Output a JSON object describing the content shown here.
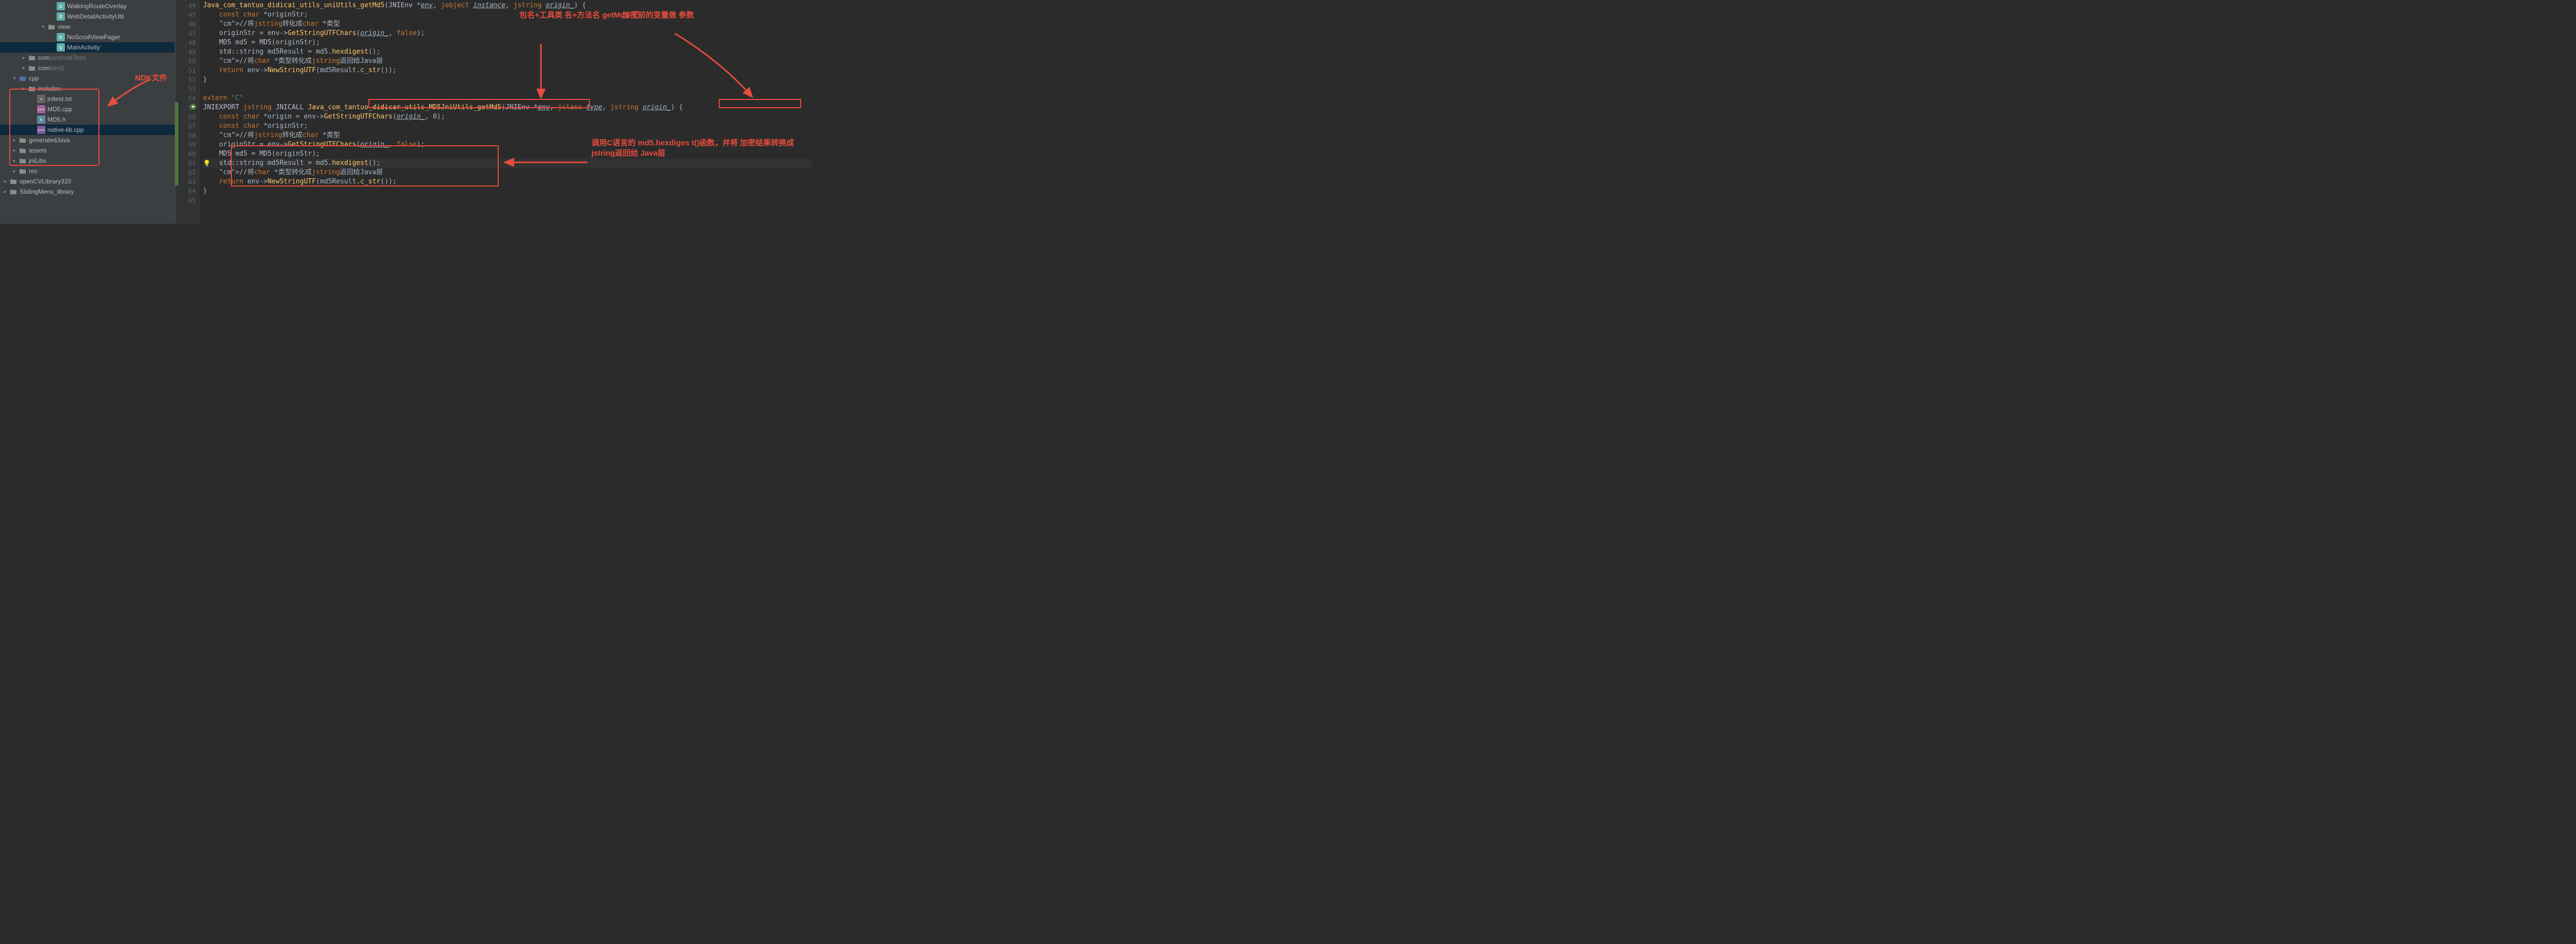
{
  "sidebar": {
    "items": [
      {
        "indent": 96,
        "arrow": "",
        "icon": "c",
        "label": "WalkingRouteOverlay"
      },
      {
        "indent": 96,
        "arrow": "",
        "icon": "c",
        "label": "WebDetailActivityUtil"
      },
      {
        "indent": 78,
        "arrow": "▾",
        "icon": "fo",
        "label": "view"
      },
      {
        "indent": 96,
        "arrow": "",
        "icon": "c",
        "label": "NoScrollViewPager"
      },
      {
        "indent": 96,
        "arrow": "",
        "icon": "c",
        "label": "MainActivity",
        "sel": true
      },
      {
        "indent": 40,
        "arrow": "▸",
        "icon": "fo",
        "label": "com",
        "suffix": " (androidTest)"
      },
      {
        "indent": 40,
        "arrow": "▸",
        "icon": "fo",
        "label": "com",
        "suffix": " (test)"
      },
      {
        "indent": 22,
        "arrow": "▾",
        "icon": "fob",
        "label": "cpp"
      },
      {
        "indent": 40,
        "arrow": "▸",
        "icon": "fo",
        "label": "includes"
      },
      {
        "indent": 58,
        "arrow": "",
        "icon": "txt",
        "label": "jnitest.txt"
      },
      {
        "indent": 58,
        "arrow": "",
        "icon": "cpp",
        "label": "MD5.cpp"
      },
      {
        "indent": 58,
        "arrow": "",
        "icon": "h",
        "label": "MD5.h"
      },
      {
        "indent": 58,
        "arrow": "",
        "icon": "cpp2",
        "label": "native-lib.cpp",
        "sel": true
      },
      {
        "indent": 22,
        "arrow": "▸",
        "icon": "fo",
        "label": "generatedJava"
      },
      {
        "indent": 22,
        "arrow": "▸",
        "icon": "fo",
        "label": "assets"
      },
      {
        "indent": 22,
        "arrow": "▸",
        "icon": "fo",
        "label": "jniLibs"
      },
      {
        "indent": 22,
        "arrow": "▸",
        "icon": "fo",
        "label": "res"
      },
      {
        "indent": 4,
        "arrow": "▸",
        "icon": "fo",
        "label": "openCVLibrary320"
      },
      {
        "indent": 4,
        "arrow": "▸",
        "icon": "fo",
        "label": "SlidingMenu_library"
      }
    ]
  },
  "gutterStart": 44,
  "gutterEnd": 65,
  "code": {
    "lines": [
      {
        "n": 44,
        "t": "Java_com_tantuo_didicai_utils_uniUtils_getMd5(JNIEnv *env, jobject instance, jstring origin_) {"
      },
      {
        "n": 45,
        "t": "    const char *originStr;"
      },
      {
        "n": 46,
        "t": "    //将jstring转化成char *类型"
      },
      {
        "n": 47,
        "t": "    originStr = env->GetStringUTFChars(origin_, false);"
      },
      {
        "n": 48,
        "t": "    MD5 md5 = MD5(originStr);"
      },
      {
        "n": 49,
        "t": "    std::string md5Result = md5.hexdigest();"
      },
      {
        "n": 50,
        "t": "    //将char *类型转化成jstring返回给Java层"
      },
      {
        "n": 51,
        "t": "    return env->NewStringUTF(md5Result.c_str());"
      },
      {
        "n": 52,
        "t": "}"
      },
      {
        "n": 53,
        "t": ""
      },
      {
        "n": 54,
        "t": "extern \"C\""
      },
      {
        "n": 55,
        "t": "JNIEXPORT jstring JNICALL Java_com_tantuo_didicar_utils_MD5JniUtils_getMd5(JNIEnv *env, jclass type, jstring origin_) {"
      },
      {
        "n": 56,
        "t": "    const char *origin = env->GetStringUTFChars(origin_, 0);"
      },
      {
        "n": 57,
        "t": "    const char *originStr;"
      },
      {
        "n": 58,
        "t": "    //将jstring转化成char *类型"
      },
      {
        "n": 59,
        "t": "    originStr = env->GetStringUTFChars(origin_, false);"
      },
      {
        "n": 60,
        "t": "    MD5 md5 = MD5(originStr);"
      },
      {
        "n": 61,
        "t": "    std::string md5Result = md5.hexdigest();"
      },
      {
        "n": 62,
        "t": "    //将char *类型转化成jstring返回给Java层"
      },
      {
        "n": 63,
        "t": "    return env->NewStringUTF(md5Result.c_str());"
      },
      {
        "n": 64,
        "t": "}"
      },
      {
        "n": 65,
        "t": ""
      }
    ]
  },
  "annotations": {
    "ndk": "NDK文件",
    "a1": "包名+工具类\n名+方法名\ngetMd5（）",
    "a2": "加密前的变量做\n参数",
    "a3": "调用C语言的\nmd5.hexdiges\nt()函数，并将\n加密结果转换成\njstring返回给\nJava层"
  }
}
